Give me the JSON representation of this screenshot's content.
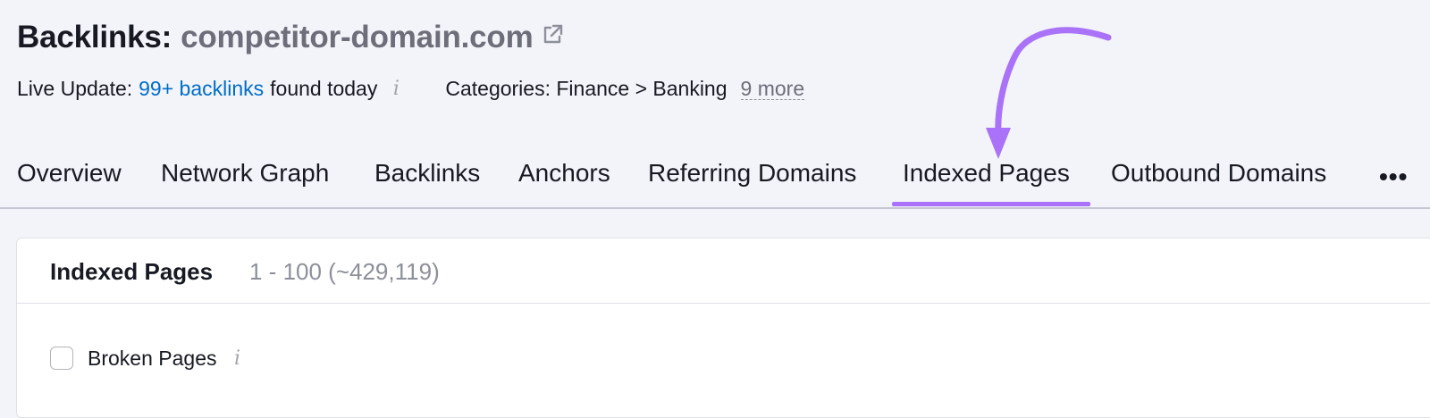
{
  "header": {
    "title_prefix": "Backlinks:",
    "domain": "competitor-domain.com",
    "domain_link_icon": "external-link-icon"
  },
  "meta": {
    "live_update_label": "Live Update:",
    "live_update_link": "99+ backlinks",
    "live_update_suffix": "found today",
    "info_icon_glyph": "i",
    "categories_label": "Categories: Finance > Banking",
    "more_link": "9 more"
  },
  "tabs": {
    "items": [
      {
        "label": "Overview"
      },
      {
        "label": "Network Graph"
      },
      {
        "label": "Backlinks"
      },
      {
        "label": "Anchors"
      },
      {
        "label": "Referring Domains"
      },
      {
        "label": "Indexed Pages",
        "active": true
      },
      {
        "label": "Outbound Domains"
      }
    ],
    "more_label": "•••"
  },
  "card": {
    "title": "Indexed Pages",
    "count": "1 - 100 (~429,119)",
    "filter": {
      "label": "Broken Pages",
      "checked": false
    }
  },
  "colors": {
    "accent": "#a972f8",
    "link": "#006dca",
    "muted": "#6c6e79",
    "background": "#f3f4f9",
    "card": "#ffffff"
  }
}
